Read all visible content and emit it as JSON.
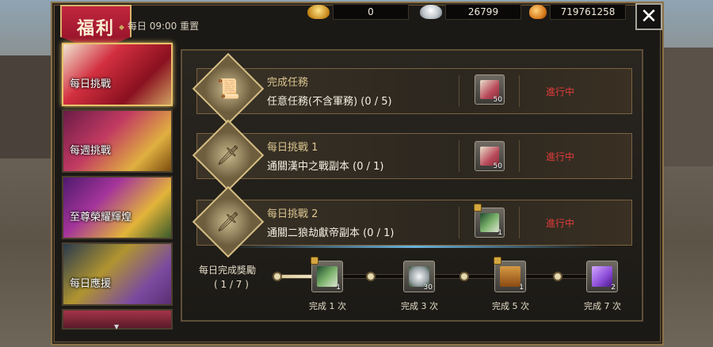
{
  "header": {
    "tab_title": "福利",
    "reset_text": "每日 09:00 重置",
    "close_label": "✕",
    "currencies": [
      {
        "name": "gold-ingot",
        "value": "0"
      },
      {
        "name": "silver-ingot",
        "value": "26799"
      },
      {
        "name": "copper-coin",
        "value": "719761258"
      }
    ]
  },
  "sidebar": {
    "items": [
      {
        "label": "每日挑戰",
        "active": true
      },
      {
        "label": "每週挑戰",
        "active": false
      },
      {
        "label": "至尊榮耀輝煌",
        "active": false
      },
      {
        "label": "每日應援",
        "active": false
      },
      {
        "label": "",
        "active": false
      }
    ]
  },
  "tasks": [
    {
      "title": "完成任務",
      "desc": "任意任務(不含軍務) (0 / 5)",
      "icon": "scroll-icon",
      "reward_icon": "treasure-box-icon",
      "reward_qty": "50",
      "status": "進行中"
    },
    {
      "title": "每日挑戰 1",
      "desc": "通關漢中之戰副本 (0 / 1)",
      "icon": "sword-icon",
      "reward_icon": "treasure-box-icon",
      "reward_qty": "50",
      "status": "進行中"
    },
    {
      "title": "每日挑戰 2",
      "desc": "通關二狼劫獻帝副本 (0 / 1)",
      "icon": "sword-icon",
      "reward_icon": "jade-sword-icon",
      "reward_qty": "1",
      "status": "進行中"
    }
  ],
  "daily": {
    "label": "每日完成獎勵",
    "count": "( 1 / 7 )",
    "progress": 0.14,
    "tiers": [
      {
        "caption": "完成 1 次",
        "qty": "1",
        "icon": "jade-sword-icon"
      },
      {
        "caption": "完成 3 次",
        "qty": "30",
        "icon": "silver-ingot-icon"
      },
      {
        "caption": "完成 5 次",
        "qty": "1",
        "icon": "treasure-chest-icon"
      },
      {
        "caption": "完成 7 次",
        "qty": "2",
        "icon": "purple-scroll-icon"
      }
    ]
  }
}
